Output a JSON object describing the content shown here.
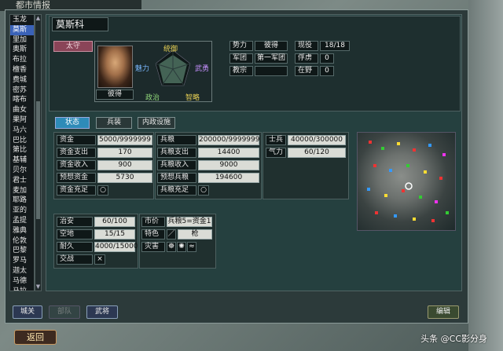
{
  "window_title": "都市情报",
  "city_list": [
    "玉龙",
    "莫斯",
    "里加",
    "奥斯",
    "布拉",
    "檀香",
    "费城",
    "密苏",
    "喀布",
    "曲女",
    "果阿",
    "马六",
    "巴比",
    "第比",
    "基辅",
    "贝尔",
    "君士",
    "麦加",
    "耶路",
    "亚的",
    "孟提",
    "雅典",
    "伦敦",
    "巴黎",
    "罗马",
    "迦太",
    "马德",
    "马拉"
  ],
  "selected_index": 1,
  "city": {
    "name": "莫斯科",
    "role": "太守",
    "governor": "彼得"
  },
  "radar_labels": {
    "defense": "统御",
    "force": "武勇",
    "wisdom": "智略",
    "politics": "政治",
    "charm": "魅力"
  },
  "affiliation": [
    {
      "label": "势力",
      "value": "彼得"
    },
    {
      "label": "军团",
      "value": "第一军团"
    },
    {
      "label": "教宗",
      "value": ""
    }
  ],
  "officers": [
    {
      "label": "现役",
      "value": "18/18"
    },
    {
      "label": "俘虏",
      "value": "0"
    },
    {
      "label": "在野",
      "value": "0"
    }
  ],
  "tabs": [
    {
      "label": "状态",
      "active": true
    },
    {
      "label": "兵装",
      "active": false
    },
    {
      "label": "内政设施",
      "active": false
    }
  ],
  "money": [
    {
      "label": "资金",
      "value": "5000/9999999"
    },
    {
      "label": "资金支出",
      "value": "170"
    },
    {
      "label": "资金收入",
      "value": "900"
    },
    {
      "label": "预想资金",
      "value": "5730"
    },
    {
      "label": "资金充足",
      "value": "○"
    }
  ],
  "food": [
    {
      "label": "兵粮",
      "value": "200000/9999999"
    },
    {
      "label": "兵粮支出",
      "value": "14400"
    },
    {
      "label": "兵粮收入",
      "value": "9000"
    },
    {
      "label": "预想兵粮",
      "value": "194600"
    },
    {
      "label": "兵粮充足",
      "value": "○"
    }
  ],
  "troops": [
    {
      "label": "士兵",
      "value": "40000/300000"
    },
    {
      "label": "气力",
      "value": "60/120"
    }
  ],
  "city_stats": [
    {
      "label": "治安",
      "value": "60/100"
    },
    {
      "label": "空地",
      "value": "15/15"
    },
    {
      "label": "耐久",
      "value": "4000/15000"
    },
    {
      "label": "交战",
      "value": "×"
    }
  ],
  "market": [
    {
      "label": "市价",
      "value": "兵粮5=资金1"
    },
    {
      "label": "特色",
      "value": "枪"
    },
    {
      "label": "灾害",
      "value": ""
    }
  ],
  "buttons": {
    "city_gate": "城关",
    "unit": "部队",
    "general": "武将",
    "edit": "编辑",
    "back": "返回"
  },
  "watermark": "头条 @CC影分身"
}
